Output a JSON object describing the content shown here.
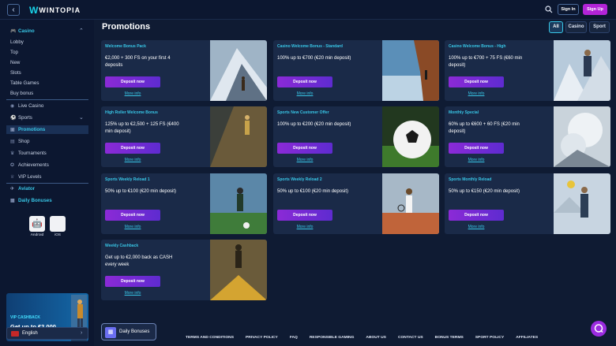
{
  "header": {
    "brand": "WINTOPIA",
    "signin_label": "Sign In",
    "signup_label": "Sign Up",
    "colors": {
      "accent": "#38c6e6",
      "brand": "#b324d8"
    }
  },
  "sidebar": {
    "casino_label": "Casino",
    "casino_items": [
      "Lobby",
      "Top",
      "New",
      "Slots",
      "Table Games",
      "Buy bonus"
    ],
    "live_casino": "Live Casino",
    "sports": "Sports",
    "promotions": "Promotions",
    "shop": "Shop",
    "tournaments": "Tournaments",
    "achievements": "Achievements",
    "vip_levels": "VIP Levels",
    "aviator": "Aviator",
    "daily_bonuses": "Daily Bonuses",
    "apps": {
      "android": "Android",
      "ios": "iOS"
    },
    "vip_card": {
      "label": "VIP CASHBACK",
      "title": "Get up to €2,000"
    },
    "language": "English"
  },
  "main": {
    "title": "Promotions",
    "filters": [
      "All",
      "Casino",
      "Sport"
    ],
    "cards": [
      {
        "tag": "Welcome Bonus Pack",
        "desc": "€2,000 + 300 FS on your first 4 deposits",
        "button": "Deposit now",
        "more": "More info"
      },
      {
        "tag": "Casino Welcome Bonus - Standard",
        "desc": "100% up to €700 (€20 min deposit)",
        "button": "Deposit now",
        "more": "More info"
      },
      {
        "tag": "Casino Welcome Bonus - High",
        "desc": "100% up to €700 + 75 FS (€60 min deposit)",
        "button": "Deposit now",
        "more": "More info"
      },
      {
        "tag": "High Roller Welcome Bonus",
        "desc": "125% up to €2,500 + 125 FS (€400 min deposit)",
        "button": "Deposit now",
        "more": "More info"
      },
      {
        "tag": "Sports New Customer Offer",
        "desc": "100% up to €200 (€20 min deposit)",
        "button": "Deposit now",
        "more": "More info"
      },
      {
        "tag": "Monthly Special",
        "desc": "60% up to €600 + 60 FS (€20 min deposit)",
        "button": "Deposit now",
        "more": "More info"
      },
      {
        "tag": "Sports Weekly Reload 1",
        "desc": "50% up to €100 (€20 min deposit)",
        "button": "Deposit now",
        "more": "More info"
      },
      {
        "tag": "Sports Weekly Reload 2",
        "desc": "50% up to €100 (€20 min deposit)",
        "button": "Deposit now",
        "more": "More info"
      },
      {
        "tag": "Sports Monthly Reload",
        "desc": "50% up to €150 (€20 min deposit)",
        "button": "Deposit now",
        "more": "More info"
      },
      {
        "tag": "Weekly Cashback",
        "desc": "Get up to €2,000 back as CASH every week",
        "button": "Deposit now",
        "more": "More info"
      }
    ]
  },
  "footer": {
    "daily_bonuses": "Daily Bonuses",
    "links": [
      "TERMS AND CONDITIONS",
      "PRIVACY POLICY",
      "FAQ",
      "RESPONSIBLE GAMING",
      "ABOUT US",
      "CONTACT US",
      "BONUS TERMS",
      "SPORT POLICY",
      "AFFILIATES"
    ]
  }
}
